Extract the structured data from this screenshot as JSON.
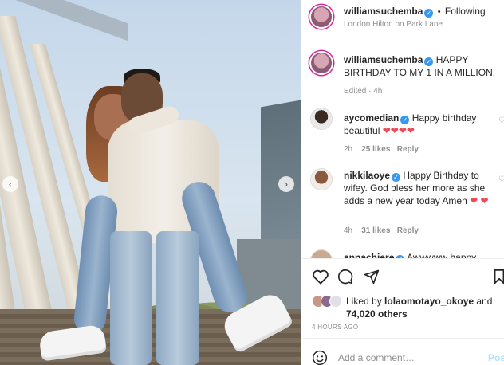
{
  "post": {
    "author": "williamsuchemba",
    "following": "Following",
    "dot": "•",
    "location": "London Hilton on Park Lane",
    "caption_text": "HAPPY BIRTHDAY TO MY 1 IN A MILLION.",
    "edited": "Edited · 4h"
  },
  "comments": [
    {
      "user": "aycomedian",
      "text": "Happy birthday beautiful",
      "hearts": "❤❤❤❤",
      "age": "2h",
      "likes": "25 likes",
      "reply": "Reply"
    },
    {
      "user": "nikkilaoye",
      "text": "Happy Birthday to wifey. God bless her more as she adds a new year today Amen",
      "hearts": "❤",
      "heart_after_amen": "❤",
      "age": "4h",
      "likes": "31 likes",
      "reply": "Reply"
    },
    {
      "user": "annachiere",
      "text": "Awwwww happy"
    }
  ],
  "likes": {
    "prefix": "Liked by",
    "user": "lolaomotayo_okoye",
    "and": "and",
    "count": "74,020 others"
  },
  "timestamp": "4 HOURS AGO",
  "comment_box": {
    "placeholder": "Add a comment…",
    "post": "Post"
  },
  "colors": {
    "verified": "#3897f0",
    "heart": "#ed4956",
    "post": "#b2dffc"
  }
}
